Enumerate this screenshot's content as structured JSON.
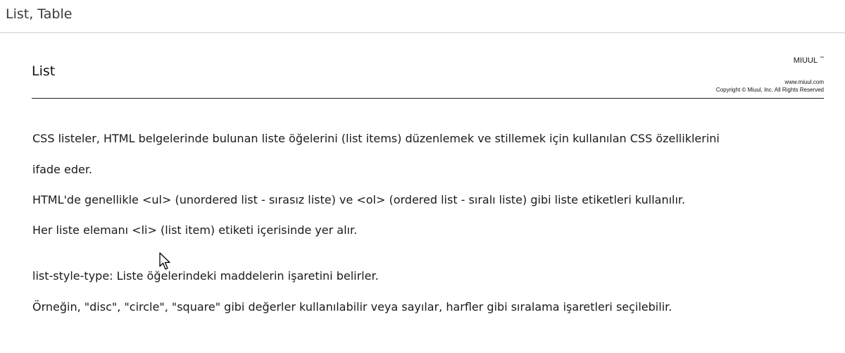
{
  "window": {
    "title": "List, Table"
  },
  "slide": {
    "heading": "List",
    "brand": "MIUUL",
    "brand_tm": "™",
    "website": "www.miuul.com",
    "copyright": "Copyright © Miuul, Inc. All Rights Reserved",
    "paragraphs": [
      "CSS listeler, HTML belgelerinde bulunan liste öğelerini (list items) düzenlemek ve stillemek için kullanılan CSS özelliklerini",
      "ifade eder.",
      "HTML'de genellikle <ul> (unordered list - sırasız liste) ve <ol> (ordered list - sıralı liste) gibi liste etiketleri kullanılır.",
      "Her liste elemanı <li> (list item) etiketi içerisinde yer alır.",
      "list-style-type: Liste öğelerindeki maddelerin işaretini belirler.",
      "Örneğin, \"disc\", \"circle\", \"square\" gibi değerler kullanılabilir veya sayılar, harfler gibi sıralama işaretleri seçilebilir."
    ]
  },
  "icons": {
    "cursor": "mouse-pointer-icon"
  }
}
